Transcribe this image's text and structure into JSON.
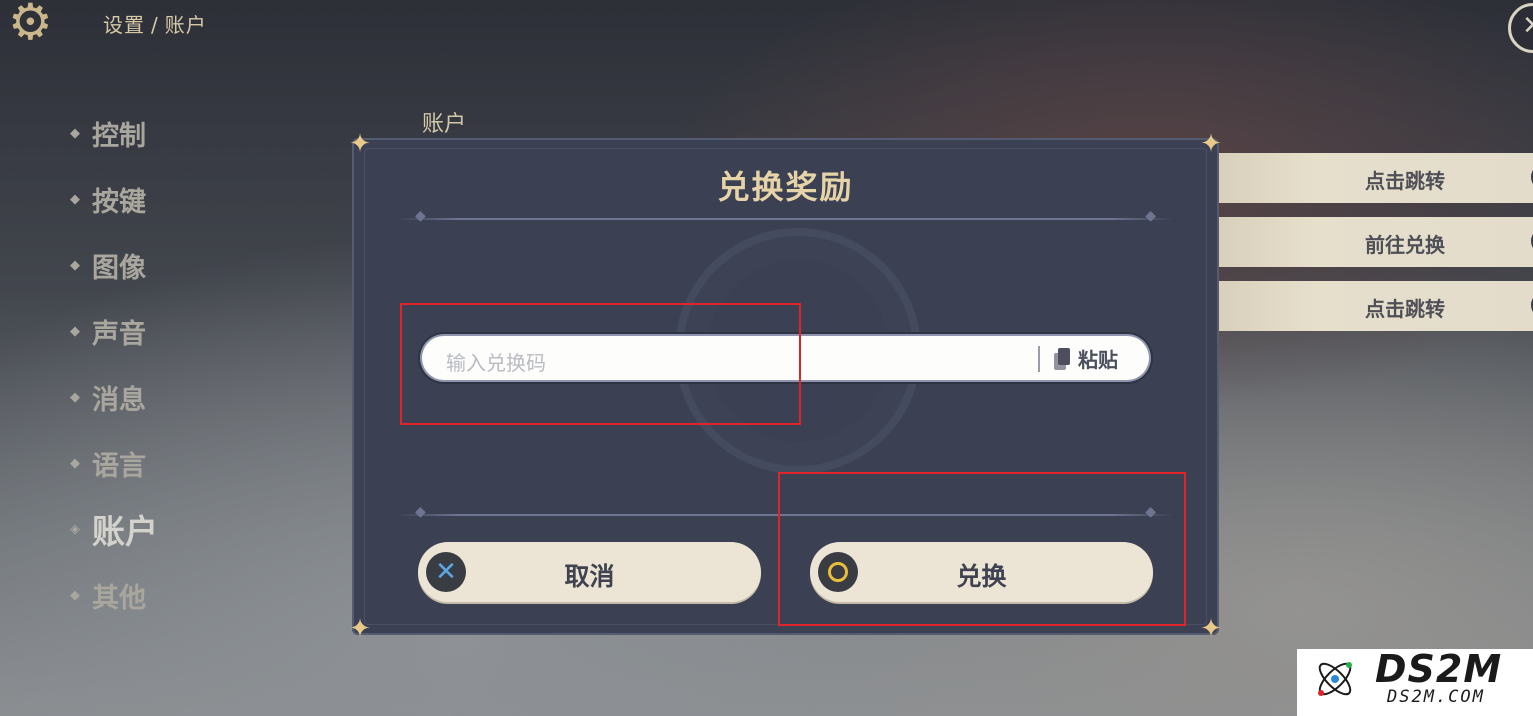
{
  "header": {
    "breadcrumb_root": "设置",
    "breadcrumb_sep": "/",
    "breadcrumb_current": "账户",
    "close_symbol": "✕"
  },
  "sidebar": {
    "items": [
      {
        "label": "控制"
      },
      {
        "label": "按键"
      },
      {
        "label": "图像"
      },
      {
        "label": "声音"
      },
      {
        "label": "消息"
      },
      {
        "label": "语言"
      },
      {
        "label": "账户",
        "active": true
      },
      {
        "label": "其他"
      }
    ]
  },
  "section": {
    "title": "账户",
    "rows": [
      {
        "label": "点击跳转"
      },
      {
        "label": "前往兑换"
      },
      {
        "label": "点击跳转"
      }
    ]
  },
  "dialog": {
    "title": "兑换奖励",
    "input_placeholder": "输入兑换码",
    "paste_label": "粘贴",
    "cancel_label": "取消",
    "confirm_label": "兑换"
  },
  "watermark": {
    "brand": "DS2M",
    "domain": "DS2M.COM"
  },
  "colors": {
    "accent": "#e6d4a8",
    "dialog_bg": "#3b4052",
    "button_bg": "#ece5d6",
    "highlight_red": "#e0252a"
  }
}
